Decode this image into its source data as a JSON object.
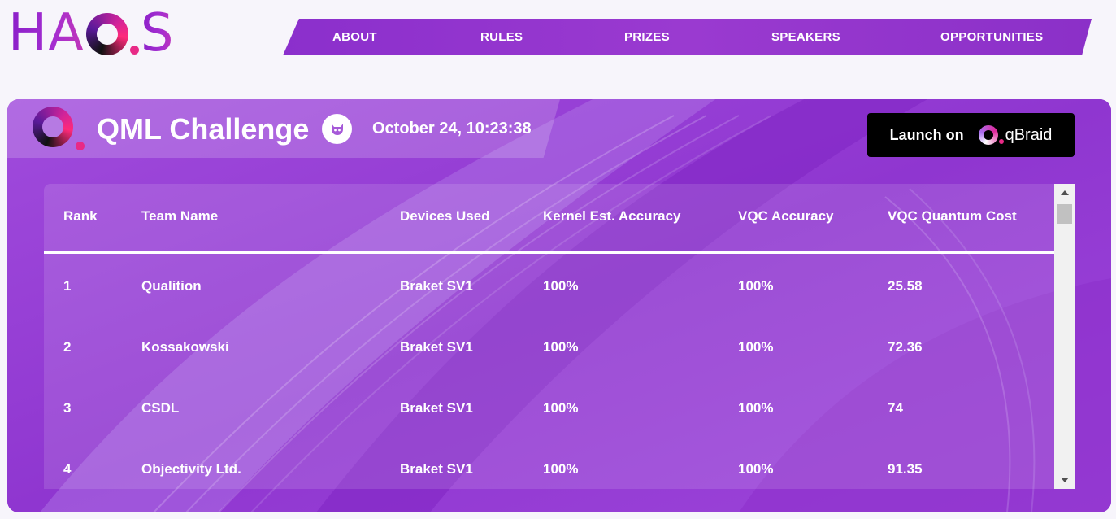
{
  "brand": {
    "logo_text_left": "HA",
    "logo_text_right": "S"
  },
  "nav": {
    "items": [
      {
        "label": "ABOUT"
      },
      {
        "label": "RULES"
      },
      {
        "label": "PRIZES"
      },
      {
        "label": "SPEAKERS"
      },
      {
        "label": "OPPORTUNITIES"
      }
    ]
  },
  "challenge": {
    "title": "QML Challenge",
    "date": "October 24, 10:23:38",
    "launch_label": "Launch on",
    "launch_brand": "qBraid"
  },
  "table": {
    "columns": [
      "Rank",
      "Team Name",
      "Devices Used",
      "Kernel Est. Accuracy",
      "VQC Accuracy",
      "VQC Quantum Cost"
    ],
    "rows": [
      [
        "1",
        "Qualition",
        "Braket SV1",
        "100%",
        "100%",
        "25.58"
      ],
      [
        "2",
        "Kossakowski",
        "Braket SV1",
        "100%",
        "100%",
        "72.36"
      ],
      [
        "3",
        "CSDL",
        "Braket SV1",
        "100%",
        "100%",
        "74"
      ],
      [
        "4",
        "Objectivity Ltd.",
        "Braket SV1",
        "100%",
        "100%",
        "91.35"
      ]
    ]
  },
  "colors": {
    "accent": "#9a3fd6",
    "nav": "#8b2fcc",
    "pink": "#e82a86"
  }
}
